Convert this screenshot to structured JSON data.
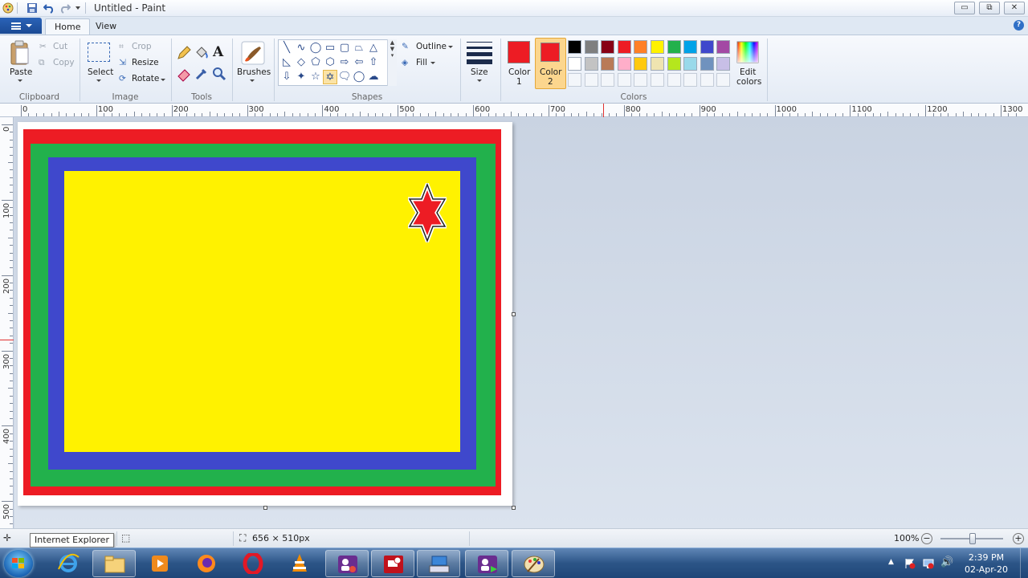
{
  "window": {
    "title": "Untitled - Paint"
  },
  "titlebar_buttons": {
    "minimize": "▭",
    "maximize": "⧉",
    "close": "✕"
  },
  "tabs": [
    {
      "label": "Home"
    },
    {
      "label": "View"
    }
  ],
  "help": "?",
  "clipboard": {
    "paste": "Paste",
    "cut": "Cut",
    "copy": "Copy",
    "group": "Clipboard"
  },
  "image": {
    "select": "Select",
    "crop": "Crop",
    "resize": "Resize",
    "rotate": "Rotate",
    "group": "Image"
  },
  "tools": {
    "group": "Tools"
  },
  "brushes": {
    "label": "Brushes"
  },
  "shapes": {
    "group": "Shapes",
    "outline": "Outline",
    "fill": "Fill"
  },
  "size": {
    "label": "Size"
  },
  "colors": {
    "group": "Colors",
    "color1_label": "Color\n1",
    "color1_line1": "Color",
    "color1_line2": "1",
    "color2_line1": "Color",
    "color2_line2": "2",
    "edit_line1": "Edit",
    "edit_line2": "colors",
    "color1": "#ed1c24",
    "color2": "#ed1c24",
    "palette_row1": [
      "#000000",
      "#7f7f7f",
      "#880015",
      "#ed1c24",
      "#ff7f27",
      "#fff200",
      "#22b14c",
      "#00a2e8",
      "#3f48cc",
      "#a349a4"
    ],
    "palette_row2": [
      "#ffffff",
      "#c3c3c3",
      "#b97a57",
      "#ffaec9",
      "#ffc90e",
      "#efe4b0",
      "#b5e61d",
      "#99d9ea",
      "#7092be",
      "#c8bfe7"
    ]
  },
  "ruler_h": [
    "0",
    "100",
    "200",
    "300",
    "400",
    "500",
    "600",
    "700",
    "800",
    "900",
    "1000",
    "1100",
    "1200",
    "1300"
  ],
  "ruler_v": [
    "0",
    "100",
    "200",
    "300",
    "400",
    "500"
  ],
  "drawing": {
    "border_colors": [
      "#ed1c24",
      "#22b14c",
      "#3f48cc",
      "#fff200"
    ],
    "star_fill": "#ed1c24"
  },
  "status": {
    "tooltip": "Internet Explorer",
    "dimensions": "656 × 510px",
    "zoom": "100%"
  },
  "taskbar": {
    "time": "2:39 PM",
    "date": "02-Apr-20"
  }
}
